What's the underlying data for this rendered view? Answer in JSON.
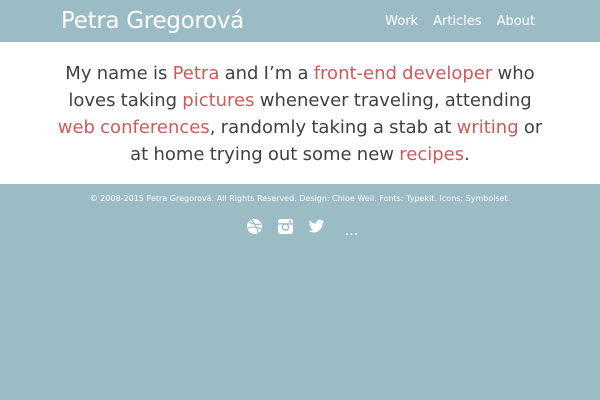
{
  "header": {
    "title": "Petra Gregorová",
    "nav": [
      "Work",
      "Articles",
      "About"
    ]
  },
  "intro": {
    "t1": "My name is ",
    "petra": "Petra",
    "t2": " and I’m a ",
    "frontend": "front-end developer",
    "t3": " who loves taking ",
    "pictures": "pictures",
    "t4": " whenever traveling, attending ",
    "webconf": "web conferences",
    "t5": ", randomly taking a stab at ",
    "writing": "writing",
    "t6": " or at home trying out some new ",
    "recipes": "recipes",
    "t7": "."
  },
  "footer": {
    "copyright": "© 2008-2015 Petra Gregorová. All Rights Reserved. Design: Chloe Weil. Fonts: Typekit. Icons: Symbolset.",
    "social": [
      "dribbble-icon",
      "instagram-icon",
      "twitter-icon"
    ],
    "more": "..."
  },
  "colors": {
    "background": "#9bbcc5",
    "link": "#cf5a5a",
    "text": "#414141"
  }
}
